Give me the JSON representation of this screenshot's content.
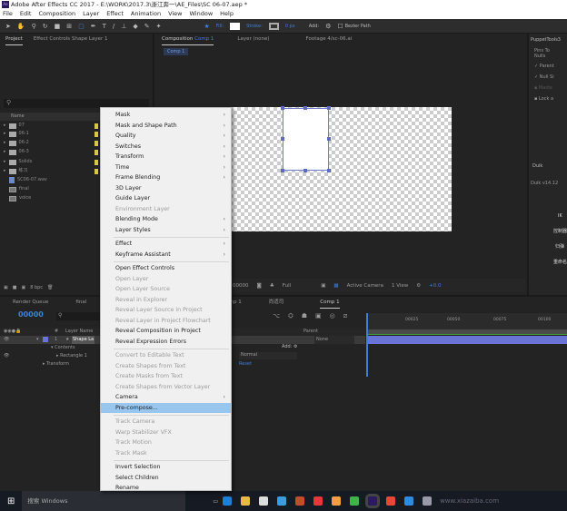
{
  "window": {
    "title": "Adobe After Effects CC 2017 - E:\\WORK\\2017.3\\浙江奔一\\AE_Files\\SC 06-07.aep *",
    "logo": "Ae"
  },
  "menubar": [
    "File",
    "Edit",
    "Composition",
    "Layer",
    "Effect",
    "Animation",
    "View",
    "Window",
    "Help"
  ],
  "toolbar": {
    "fill_label": "Fill:",
    "stroke_label": "Stroke:",
    "stroke_width": "0 px",
    "add_label": "Add:",
    "bezier_label": "Bezier Path"
  },
  "project": {
    "tabs": [
      "Project",
      "Effect Controls Shape Layer 1"
    ],
    "column_name": "Name",
    "search_icon": "search-icon",
    "items": [
      {
        "name": "07",
        "type": "folder"
      },
      {
        "name": "06-1",
        "type": "folder"
      },
      {
        "name": "06-2",
        "type": "folder"
      },
      {
        "name": "06-3",
        "type": "folder"
      },
      {
        "name": "Solids",
        "type": "folder"
      },
      {
        "name": "练习",
        "type": "folder"
      },
      {
        "name": "SC06-07.wav",
        "type": "audio"
      },
      {
        "name": "final",
        "type": "comp"
      },
      {
        "name": "voice",
        "type": "comp"
      }
    ],
    "bpc": "8 bpc"
  },
  "viewer": {
    "tabs": {
      "composition": "Composition",
      "comp_name": "Comp 1",
      "layer": "Layer (none)",
      "footage": "Footage",
      "footage_file": "4/sc-06.ai"
    },
    "breadcrumb": "Comp 1",
    "bar": {
      "timecode": "00000",
      "resolution": "Full",
      "camera": "Active Camera",
      "views": "1 View",
      "exposure": "+0.0"
    }
  },
  "right_panel": {
    "title": "PuppetTools3",
    "pins_label": "Pins To Nulls",
    "options": [
      {
        "label": "Parent",
        "checked": true
      },
      {
        "label": "Null Si",
        "checked": true
      },
      {
        "label": "Maste",
        "checked": false
      },
      {
        "label": "Lock a",
        "checked": false
      }
    ],
    "duik_title": "Duik",
    "duik_version": "Duik v14.12",
    "duik_items": [
      "IK",
      "控制器",
      "归弹",
      "重命名"
    ]
  },
  "context_menu": {
    "items": [
      {
        "label": "Mask",
        "sub": true
      },
      {
        "label": "Mask and Shape Path",
        "sub": true
      },
      {
        "label": "Quality",
        "sub": true
      },
      {
        "label": "Switches",
        "sub": true
      },
      {
        "label": "Transform",
        "sub": true
      },
      {
        "label": "Time",
        "sub": true
      },
      {
        "label": "Frame Blending",
        "sub": true
      },
      {
        "label": "3D Layer"
      },
      {
        "label": "Guide Layer"
      },
      {
        "label": "Environment Layer",
        "disabled": true
      },
      {
        "label": "Blending Mode",
        "sub": true
      },
      {
        "label": "Layer Styles",
        "sub": true
      },
      {
        "sep": true
      },
      {
        "label": "Effect",
        "sub": true
      },
      {
        "label": "Keyframe Assistant",
        "sub": true
      },
      {
        "sep": true
      },
      {
        "label": "Open Effect Controls"
      },
      {
        "label": "Open Layer",
        "disabled": true
      },
      {
        "label": "Open Layer Source",
        "disabled": true
      },
      {
        "label": "Reveal in Explorer",
        "disabled": true
      },
      {
        "label": "Reveal Layer Source in Project",
        "disabled": true
      },
      {
        "label": "Reveal Layer in Project Flowchart",
        "disabled": true
      },
      {
        "label": "Reveal Composition in Project"
      },
      {
        "label": "Reveal Expression Errors"
      },
      {
        "sep": true
      },
      {
        "label": "Convert to Editable Text",
        "disabled": true
      },
      {
        "label": "Create Shapes from Text",
        "disabled": true
      },
      {
        "label": "Create Masks from Text",
        "disabled": true
      },
      {
        "label": "Create Shapes from Vector Layer",
        "disabled": true
      },
      {
        "label": "Camera",
        "sub": true
      },
      {
        "label": "Pre-compose...",
        "highlighted": true
      },
      {
        "sep": true
      },
      {
        "label": "Track Camera",
        "disabled": true
      },
      {
        "label": "Warp Stabilizer VFX",
        "disabled": true
      },
      {
        "label": "Track Motion",
        "disabled": true
      },
      {
        "label": "Track Mask",
        "disabled": true
      },
      {
        "sep": true
      },
      {
        "label": "Invert Selection"
      },
      {
        "label": "Select Children"
      },
      {
        "label": "Rename"
      }
    ]
  },
  "timeline": {
    "tabs": [
      "Render Queue",
      "final",
      "comp 1",
      "尚适司",
      "Comp 1"
    ],
    "timecode": "00000",
    "columns": {
      "num": "#",
      "layer_name": "Layer Name",
      "parent": "Parent"
    },
    "layer": {
      "index": "1",
      "name": "Shape La",
      "parent": "None"
    },
    "contents": "Contents",
    "rectangle": "Rectangle 1",
    "transform": "Transform",
    "add_label": "Add:",
    "blend_mode": "Normal",
    "reset": "Reset",
    "ruler": [
      "00025",
      "00050",
      "00075",
      "00100"
    ]
  },
  "taskbar": {
    "search": "搜索 Windows",
    "watermark": "www.xiazaiba.com"
  },
  "colors": {
    "accent": "#3f7fd9",
    "menu_highlight": "#98c6ee",
    "layer_bar": "#6a73d8",
    "label_yellow": "#d6c94a"
  }
}
